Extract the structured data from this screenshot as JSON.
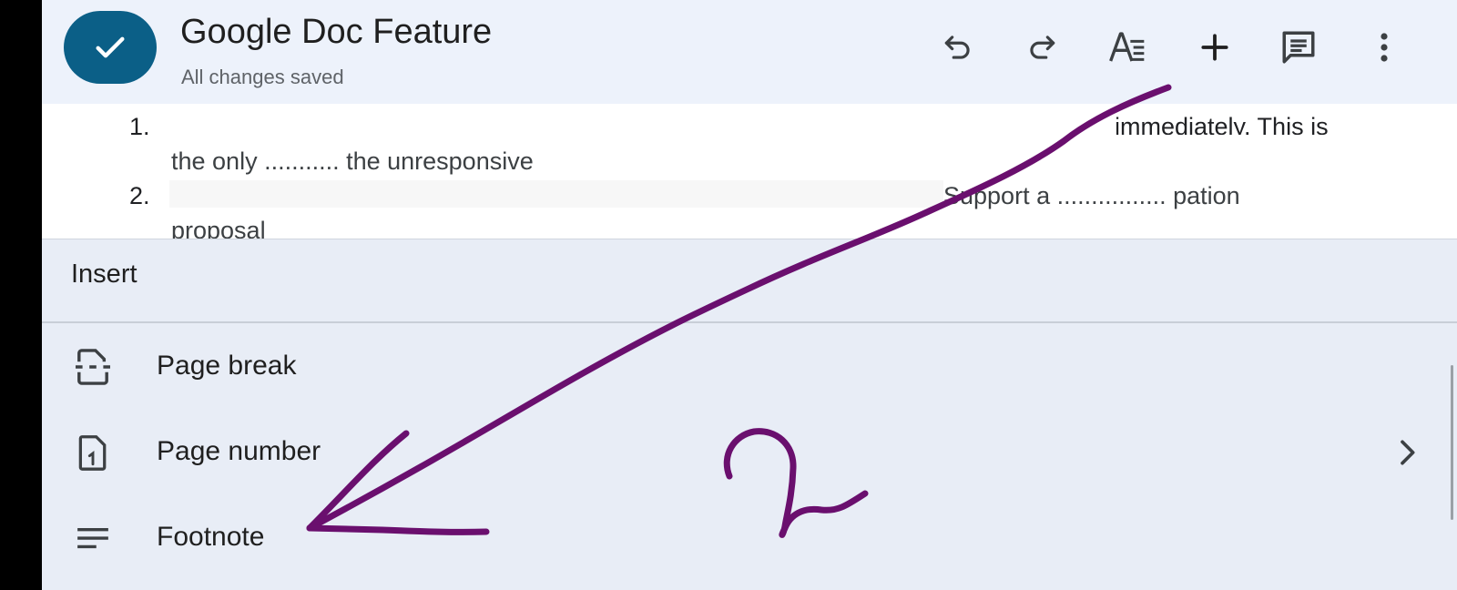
{
  "header": {
    "title": "Google Doc Feature",
    "status": "All changes saved",
    "icons": [
      "checkmark-icon",
      "undo-icon",
      "redo-icon",
      "text-format-icon",
      "plus-icon",
      "comment-icon",
      "more-vert-icon"
    ]
  },
  "document": {
    "items": [
      {
        "number": "1.",
        "line1": "immediately. This is",
        "line2": "the only ........... the unresponsive"
      },
      {
        "number": "2.",
        "line1": "Support a ................ pation",
        "line2": "proposal"
      }
    ]
  },
  "sheet": {
    "title": "Insert",
    "items": [
      {
        "label": "Page break",
        "icon": "page-break-icon"
      },
      {
        "label": "Page number",
        "icon": "page-number-icon",
        "has_submenu": true
      },
      {
        "label": "Footnote",
        "icon": "footnote-icon"
      }
    ]
  },
  "annotation": {
    "text": "2",
    "color": "#6a0f6e"
  },
  "colors": {
    "accent": "#0b5f87",
    "header_bg": "#edf2fb",
    "sheet_bg": "#e8edf6"
  }
}
